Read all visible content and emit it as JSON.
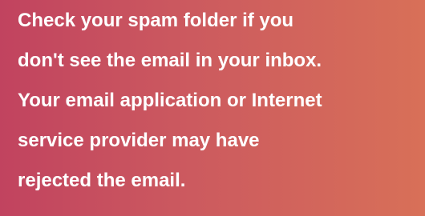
{
  "notice": {
    "lines": [
      "Check your spam folder if you",
      "don't see the email in your inbox.",
      "Your email application or Internet",
      "service provider may have",
      "rejected the email."
    ]
  },
  "colors": {
    "background_start": "#c1435f",
    "background_end": "#d87058",
    "text": "#ffffff"
  }
}
